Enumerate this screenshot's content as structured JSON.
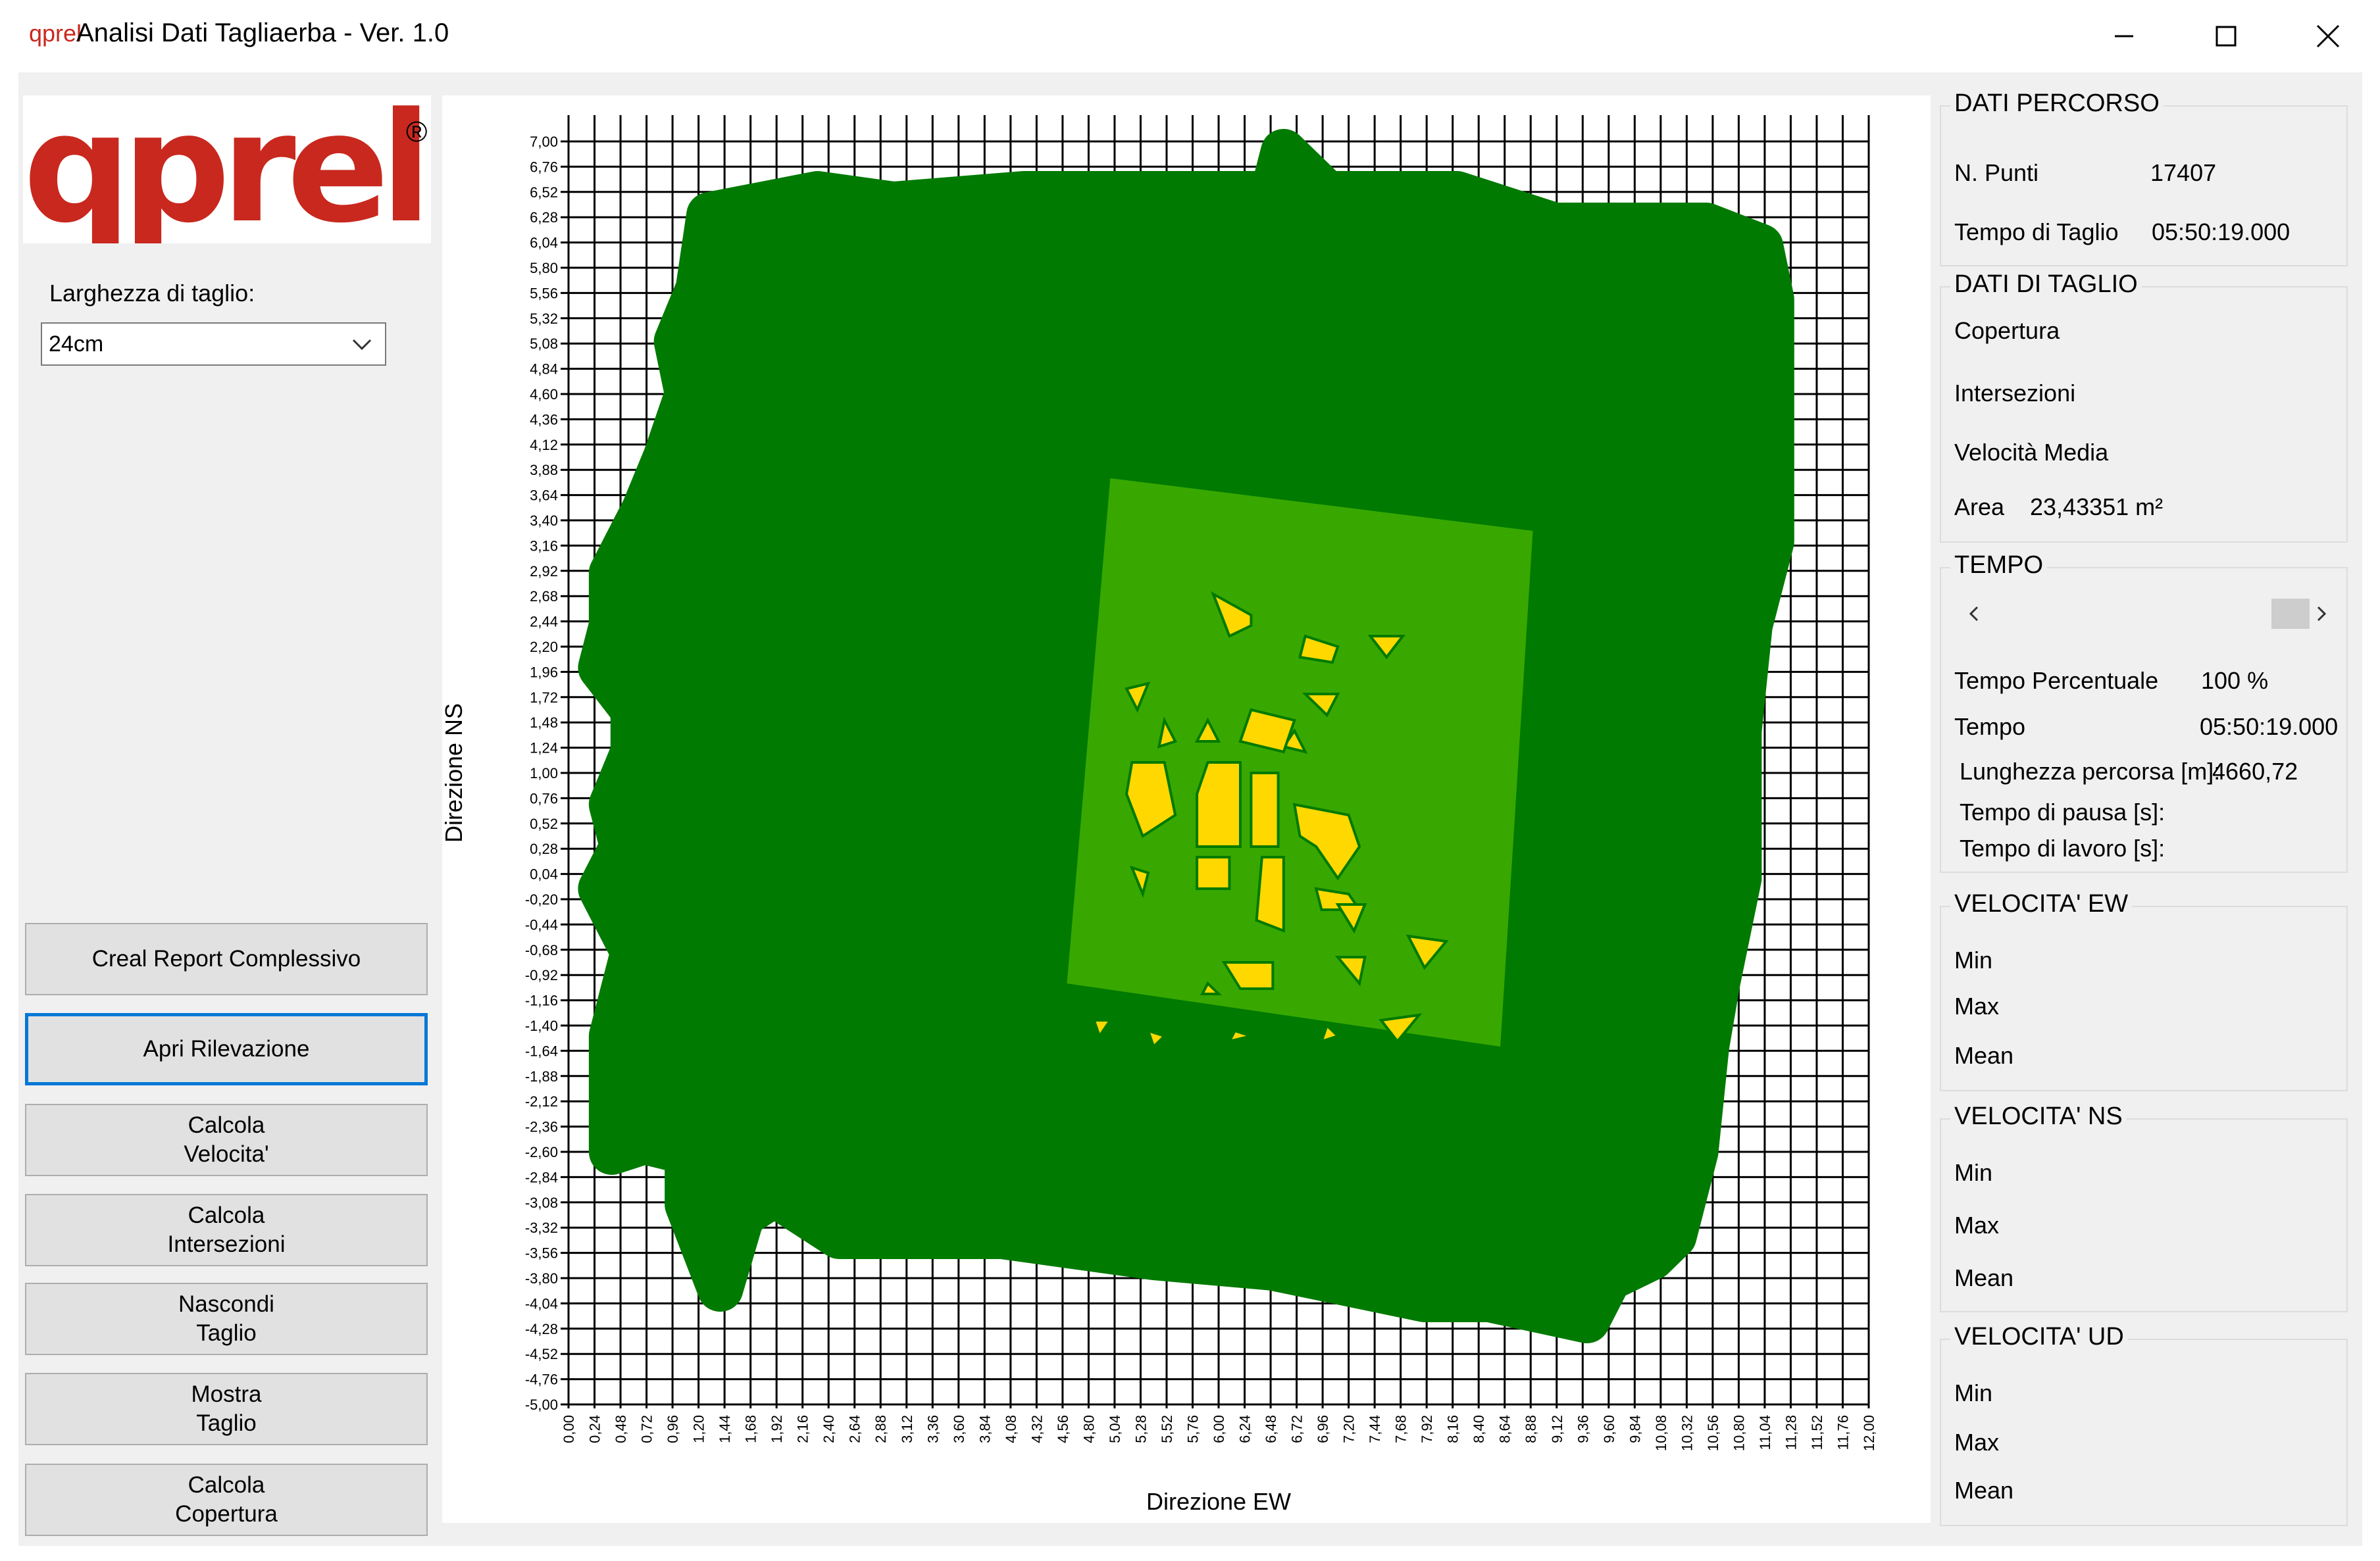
{
  "window": {
    "icon": "qprel",
    "title": "Analisi Dati Tagliaerba - Ver. 1.0",
    "controls": [
      "minimize-icon",
      "maximize-icon",
      "close-icon"
    ]
  },
  "logo": {
    "text": "qprel",
    "mark": "®",
    "color": "#c8281e"
  },
  "left": {
    "width_label": "Larghezza di taglio:",
    "width_value": "24cm",
    "buttons": {
      "report": "Creal Report Complessivo",
      "apri": "Apri Rilevazione",
      "velocita": "Calcola\nVelocita'",
      "intersezioni": "Calcola\nIntersezioni",
      "nascondi": "Nascondi\nTaglio",
      "mostra": "Mostra\nTaglio",
      "copertura": "Calcola\nCopertura"
    }
  },
  "chart_data": {
    "type": "scatter",
    "xlabel": "Direzione EW",
    "ylabel": "Direzione NS",
    "xlim": [
      0,
      12
    ],
    "ylim": [
      -5,
      7
    ],
    "x_step": 0.24,
    "y_step": 0.24,
    "x_ticks": [
      "0,00",
      "0,24",
      "0,48",
      "0,72",
      "0,96",
      "1,20",
      "1,44",
      "1,68",
      "1,92",
      "2,16",
      "2,40",
      "2,64",
      "2,88",
      "3,12",
      "3,36",
      "3,60",
      "3,84",
      "4,08",
      "4,32",
      "4,56",
      "4,80",
      "5,04",
      "5,28",
      "5,52",
      "5,76",
      "6,00",
      "6,24",
      "6,48",
      "6,72",
      "6,96",
      "7,20",
      "7,44",
      "7,68",
      "7,92",
      "8,16",
      "8,40",
      "8,64",
      "8,88",
      "9,12",
      "9,36",
      "9,60",
      "9,84",
      "10,08",
      "10,32",
      "10,56",
      "10,80",
      "11,04",
      "11,28",
      "11,52",
      "11,76",
      "12,00"
    ],
    "y_ticks": [
      "7,00",
      "6,76",
      "6,52",
      "6,28",
      "6,04",
      "5,80",
      "5,56",
      "5,32",
      "5,08",
      "4,84",
      "4,60",
      "4,36",
      "4,12",
      "3,88",
      "3,64",
      "3,40",
      "3,16",
      "2,92",
      "2,68",
      "2,44",
      "2,20",
      "1,96",
      "1,72",
      "1,48",
      "1,24",
      "1,00",
      "0,76",
      "0,52",
      "0,28",
      "0,04",
      "-0,20",
      "-0,44",
      "-0,68",
      "-0,92",
      "-1,16",
      "-1,40",
      "-1,64",
      "-1,88",
      "-2,12",
      "-2,36",
      "-2,60",
      "-2,84",
      "-3,08",
      "-3,32",
      "-3,56",
      "-3,80",
      "-4,04",
      "-4,28",
      "-4,52",
      "-4,76",
      "-5,00"
    ],
    "grid": true,
    "colors": {
      "path": "#007a00",
      "area": "#38a800",
      "uncut": "#ffd800"
    },
    "path_outline": [
      [
        1.3,
        6.3
      ],
      [
        2.3,
        6.5
      ],
      [
        3.0,
        6.4
      ],
      [
        4.2,
        6.5
      ],
      [
        6.5,
        6.5
      ],
      [
        6.6,
        6.9
      ],
      [
        7.0,
        6.5
      ],
      [
        8.2,
        6.5
      ],
      [
        9.1,
        6.2
      ],
      [
        10.5,
        6.2
      ],
      [
        11.0,
        6.0
      ],
      [
        11.1,
        5.5
      ],
      [
        11.1,
        3.2
      ],
      [
        10.9,
        2.4
      ],
      [
        10.8,
        1.4
      ],
      [
        10.8,
        0.0
      ],
      [
        10.6,
        -1.0
      ],
      [
        10.5,
        -1.6
      ],
      [
        10.4,
        -2.6
      ],
      [
        10.2,
        -3.4
      ],
      [
        10.0,
        -3.6
      ],
      [
        9.6,
        -3.8
      ],
      [
        9.4,
        -4.2
      ],
      [
        8.5,
        -4.0
      ],
      [
        7.9,
        -4.0
      ],
      [
        6.5,
        -3.7
      ],
      [
        5.4,
        -3.6
      ],
      [
        4.0,
        -3.4
      ],
      [
        2.5,
        -3.4
      ],
      [
        1.9,
        -3.0
      ],
      [
        1.6,
        -3.2
      ],
      [
        1.4,
        -3.9
      ],
      [
        1.1,
        -3.1
      ],
      [
        1.1,
        -2.6
      ],
      [
        0.7,
        -2.5
      ],
      [
        0.4,
        -2.6
      ],
      [
        0.4,
        -1.5
      ],
      [
        0.6,
        -0.7
      ],
      [
        0.3,
        -0.1
      ],
      [
        0.5,
        0.3
      ],
      [
        0.4,
        0.7
      ],
      [
        0.6,
        1.2
      ],
      [
        0.6,
        1.6
      ],
      [
        0.3,
        2.0
      ],
      [
        0.4,
        2.4
      ],
      [
        0.4,
        2.9
      ],
      [
        0.7,
        3.5
      ],
      [
        0.9,
        4.0
      ],
      [
        1.1,
        4.6
      ],
      [
        1.0,
        5.1
      ],
      [
        1.2,
        5.6
      ],
      [
        1.3,
        6.3
      ]
    ],
    "area_polygon": [
      [
        5.0,
        3.8
      ],
      [
        8.9,
        3.3
      ],
      [
        8.6,
        -1.6
      ],
      [
        4.6,
        -1.0
      ]
    ],
    "uncut_patches": [
      [
        [
          5.95,
          2.7
        ],
        [
          6.3,
          2.5
        ],
        [
          6.3,
          2.4
        ],
        [
          6.1,
          2.3
        ]
      ],
      [
        [
          6.8,
          2.3
        ],
        [
          7.1,
          2.2
        ],
        [
          7.05,
          2.05
        ],
        [
          6.75,
          2.1
        ]
      ],
      [
        [
          7.4,
          2.3
        ],
        [
          7.7,
          2.3
        ],
        [
          7.55,
          2.1
        ]
      ],
      [
        [
          5.15,
          1.8
        ],
        [
          5.35,
          1.85
        ],
        [
          5.25,
          1.6
        ]
      ],
      [
        [
          6.8,
          1.75
        ],
        [
          7.1,
          1.75
        ],
        [
          7.0,
          1.55
        ]
      ],
      [
        [
          5.5,
          1.5
        ],
        [
          5.6,
          1.3
        ],
        [
          5.45,
          1.25
        ]
      ],
      [
        [
          6.7,
          1.4
        ],
        [
          6.8,
          1.2
        ],
        [
          6.6,
          1.25
        ]
      ],
      [
        [
          5.9,
          1.5
        ],
        [
          6.0,
          1.3
        ],
        [
          5.8,
          1.3
        ]
      ],
      [
        [
          6.3,
          1.6
        ],
        [
          6.7,
          1.5
        ],
        [
          6.6,
          1.2
        ],
        [
          6.2,
          1.3
        ]
      ],
      [
        [
          5.2,
          1.1
        ],
        [
          5.5,
          1.1
        ],
        [
          5.6,
          0.6
        ],
        [
          5.3,
          0.4
        ],
        [
          5.15,
          0.8
        ]
      ],
      [
        [
          5.9,
          1.1
        ],
        [
          6.2,
          1.1
        ],
        [
          6.2,
          0.3
        ],
        [
          5.8,
          0.3
        ],
        [
          5.8,
          0.8
        ]
      ],
      [
        [
          6.3,
          1.0
        ],
        [
          6.55,
          1.0
        ],
        [
          6.55,
          0.3
        ],
        [
          6.3,
          0.3
        ]
      ],
      [
        [
          6.7,
          0.7
        ],
        [
          7.2,
          0.6
        ],
        [
          7.3,
          0.3
        ],
        [
          7.1,
          0.0
        ],
        [
          6.9,
          0.3
        ],
        [
          6.75,
          0.4
        ]
      ],
      [
        [
          5.8,
          0.2
        ],
        [
          6.1,
          0.2
        ],
        [
          6.1,
          -0.1
        ],
        [
          5.8,
          -0.1
        ]
      ],
      [
        [
          6.4,
          0.2
        ],
        [
          6.6,
          0.2
        ],
        [
          6.6,
          -0.5
        ],
        [
          6.35,
          -0.4
        ]
      ],
      [
        [
          5.2,
          0.1
        ],
        [
          5.35,
          0.05
        ],
        [
          5.3,
          -0.15
        ]
      ],
      [
        [
          6.9,
          -0.1
        ],
        [
          7.2,
          -0.15
        ],
        [
          7.3,
          -0.3
        ],
        [
          6.95,
          -0.3
        ]
      ],
      [
        [
          7.1,
          -0.25
        ],
        [
          7.35,
          -0.25
        ],
        [
          7.25,
          -0.5
        ]
      ],
      [
        [
          7.75,
          -0.55
        ],
        [
          8.1,
          -0.6
        ],
        [
          7.9,
          -0.85
        ]
      ],
      [
        [
          6.05,
          -0.8
        ],
        [
          6.5,
          -0.8
        ],
        [
          6.5,
          -1.05
        ],
        [
          6.2,
          -1.05
        ]
      ],
      [
        [
          5.9,
          -1.0
        ],
        [
          6.0,
          -1.1
        ],
        [
          5.85,
          -1.1
        ]
      ],
      [
        [
          7.1,
          -0.75
        ],
        [
          7.35,
          -0.75
        ],
        [
          7.3,
          -1.0
        ]
      ],
      [
        [
          7.5,
          -1.35
        ],
        [
          7.85,
          -1.3
        ],
        [
          7.65,
          -1.55
        ]
      ],
      [
        [
          5.35,
          -1.45
        ],
        [
          5.5,
          -1.5
        ],
        [
          5.4,
          -1.6
        ]
      ],
      [
        [
          4.85,
          -1.35
        ],
        [
          5.0,
          -1.35
        ],
        [
          4.9,
          -1.5
        ]
      ],
      [
        [
          6.15,
          -1.45
        ],
        [
          6.3,
          -1.5
        ],
        [
          6.1,
          -1.55
        ]
      ],
      [
        [
          7.0,
          -1.4
        ],
        [
          7.1,
          -1.5
        ],
        [
          6.95,
          -1.55
        ]
      ]
    ]
  },
  "right": {
    "percorso": {
      "title": "DATI PERCORSO",
      "n_punti_label": "N. Punti",
      "n_punti_value": "17407",
      "tempo_taglio_label": "Tempo di Taglio",
      "tempo_taglio_value": "05:50:19.000"
    },
    "taglio": {
      "title": "DATI DI TAGLIO",
      "copertura_label": "Copertura",
      "intersezioni_label": "Intersezioni",
      "velocita_label": "Velocità Media",
      "area_label": "Area",
      "area_value": "23,43351 m²"
    },
    "tempo": {
      "title": "TEMPO",
      "slider_level": 1.0,
      "percentuale_label": "Tempo Percentuale",
      "percentuale_value": "100 %",
      "tempo_label": "Tempo",
      "tempo_value": "05:50:19.000",
      "lunghezza_label": "Lunghezza percorsa [m]:",
      "lunghezza_value": "4660,72",
      "pausa_label": "Tempo di pausa [s]:",
      "lavoro_label": "Tempo di lavoro [s]:"
    },
    "vew": {
      "title": "VELOCITA' EW",
      "min": "Min",
      "max": "Max",
      "mean": "Mean"
    },
    "vns": {
      "title": "VELOCITA' NS",
      "min": "Min",
      "max": "Max",
      "mean": "Mean"
    },
    "vud": {
      "title": "VELOCITA' UD",
      "min": "Min",
      "max": "Max",
      "mean": "Mean"
    }
  }
}
